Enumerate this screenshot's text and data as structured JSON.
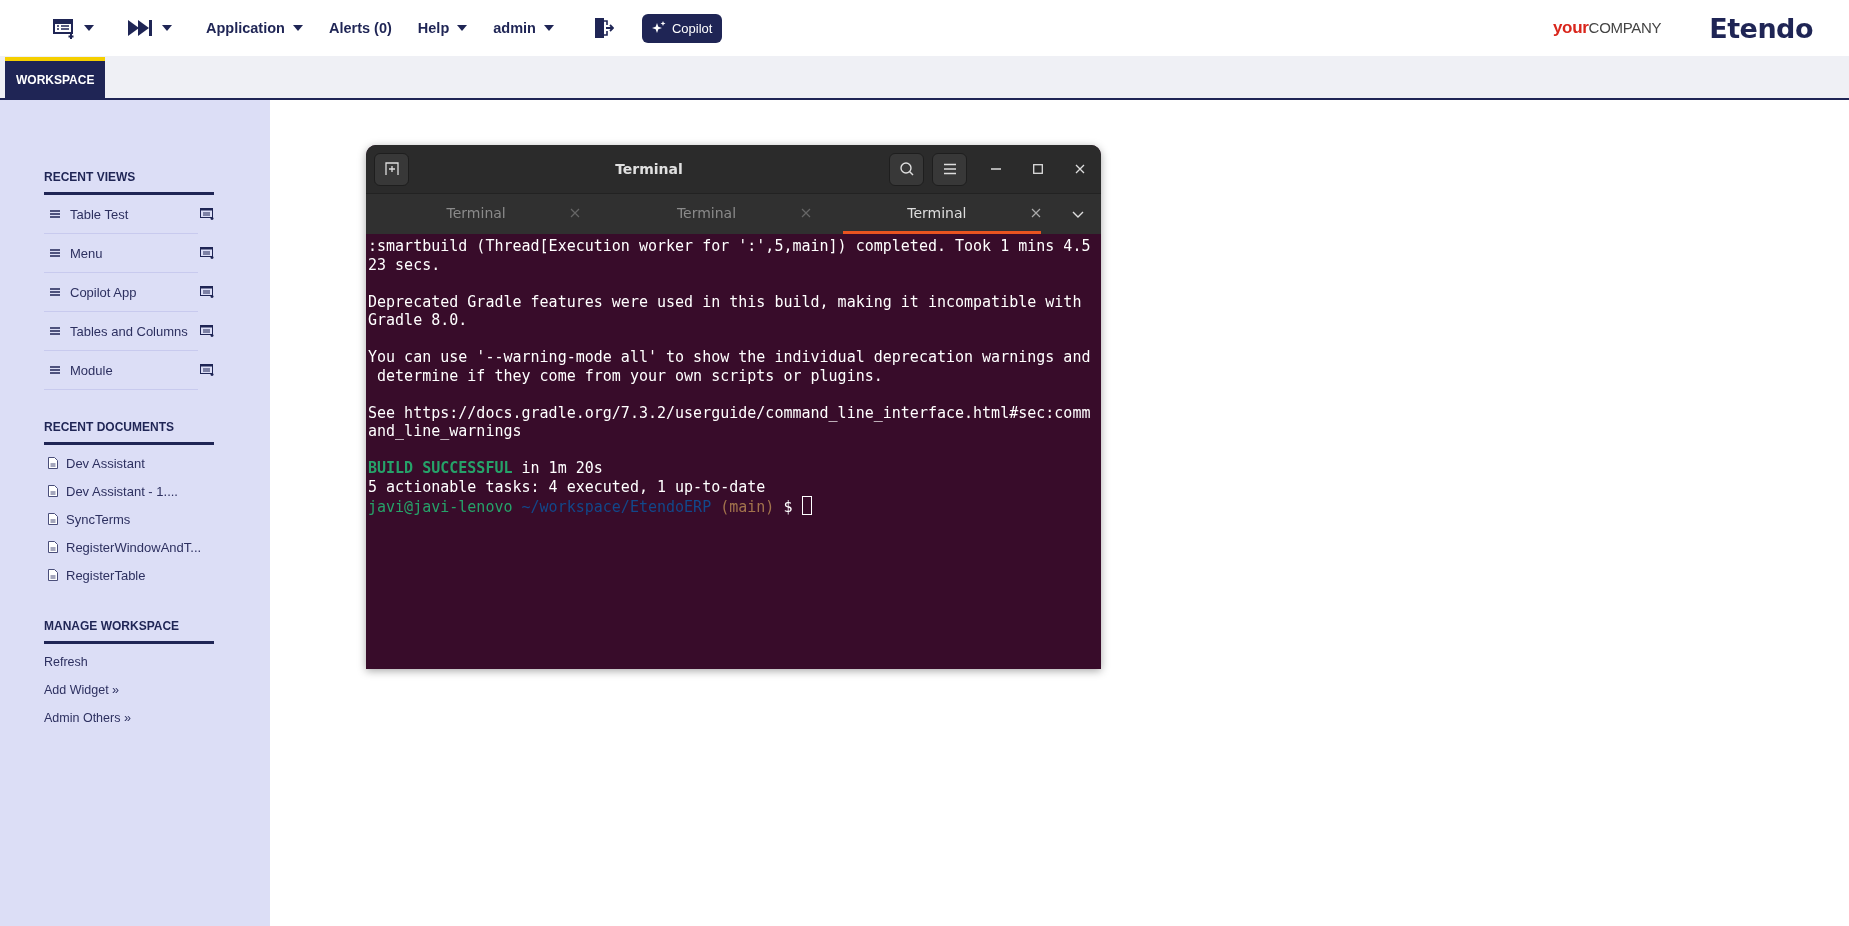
{
  "top_bar": {
    "menus": [
      {
        "kind": "workspace"
      },
      {
        "kind": "navigation"
      },
      {
        "kind": "text",
        "label": "Application"
      },
      {
        "kind": "plain",
        "label": "Alerts (0)"
      },
      {
        "kind": "text",
        "label": "Help"
      },
      {
        "kind": "text",
        "label": "admin"
      }
    ],
    "copilot": {
      "label": "Copilot"
    },
    "logo": {
      "prefix": "your",
      "suffix": "COMPANY"
    },
    "brand": "Etendo"
  },
  "tabs": [
    {
      "label": "WORKSPACE",
      "selected": true
    }
  ],
  "sidebar": {
    "sections": [
      {
        "title": "RECENT VIEWS",
        "kind": "views",
        "items": [
          "Table Test",
          "Menu",
          "Copilot App",
          "Tables and Columns",
          "Module"
        ]
      },
      {
        "title": "RECENT DOCUMENTS",
        "kind": "documents",
        "items": [
          "Dev Assistant",
          "Dev Assistant - 1....",
          "SyncTerms",
          "RegisterWindowAndT...",
          "RegisterTable"
        ]
      },
      {
        "title": "MANAGE WORKSPACE",
        "kind": "links",
        "items": [
          "Refresh",
          "Add Widget »",
          "Admin Others »"
        ]
      }
    ]
  },
  "terminal": {
    "title": "Terminal",
    "tabs": [
      {
        "label": "Terminal",
        "selected": false
      },
      {
        "label": "Terminal",
        "selected": false
      },
      {
        "label": "Terminal",
        "selected": true
      }
    ],
    "blocks": [
      [
        [
          {
            "kind": "plain",
            "text": ":smartbuild (Thread[Execution worker for ':',5,main]) completed. Took 1 mins 4.5"
          }
        ],
        [
          {
            "kind": "plain",
            "text": "23 secs."
          }
        ]
      ],
      [
        [
          {
            "kind": "plain",
            "text": "Deprecated Gradle features were used in this build, making it incompatible with"
          }
        ],
        [
          {
            "kind": "plain",
            "text": "Gradle 8.0."
          }
        ]
      ],
      [
        [
          {
            "kind": "plain",
            "text": "You can use '--warning-mode all' to show the individual deprecation warnings and"
          }
        ],
        [
          {
            "kind": "plain",
            "text": " determine if they come from your own scripts or plugins."
          }
        ]
      ],
      [
        [
          {
            "kind": "plain",
            "text": "See https://docs.gradle.org/7.3.2/userguide/command_line_interface.html#sec:comm"
          }
        ],
        [
          {
            "kind": "plain",
            "text": "and_line_warnings"
          }
        ]
      ],
      [
        [
          {
            "kind": "success",
            "text": "BUILD SUCCESSFUL"
          },
          {
            "kind": "plain",
            "text": " in 1m 20s"
          }
        ],
        [
          {
            "kind": "plain",
            "text": "5 actionable tasks: 4 executed, 1 up-to-date"
          }
        ],
        [
          {
            "kind": "user",
            "text": "javi@javi-lenovo"
          },
          {
            "kind": "path",
            "text": " ~/workspace/EtendoERP"
          },
          {
            "kind": "branch",
            "text": " (main)"
          },
          {
            "kind": "plain",
            "text": " $ "
          },
          {
            "kind": "cursor"
          }
        ]
      ]
    ]
  }
}
